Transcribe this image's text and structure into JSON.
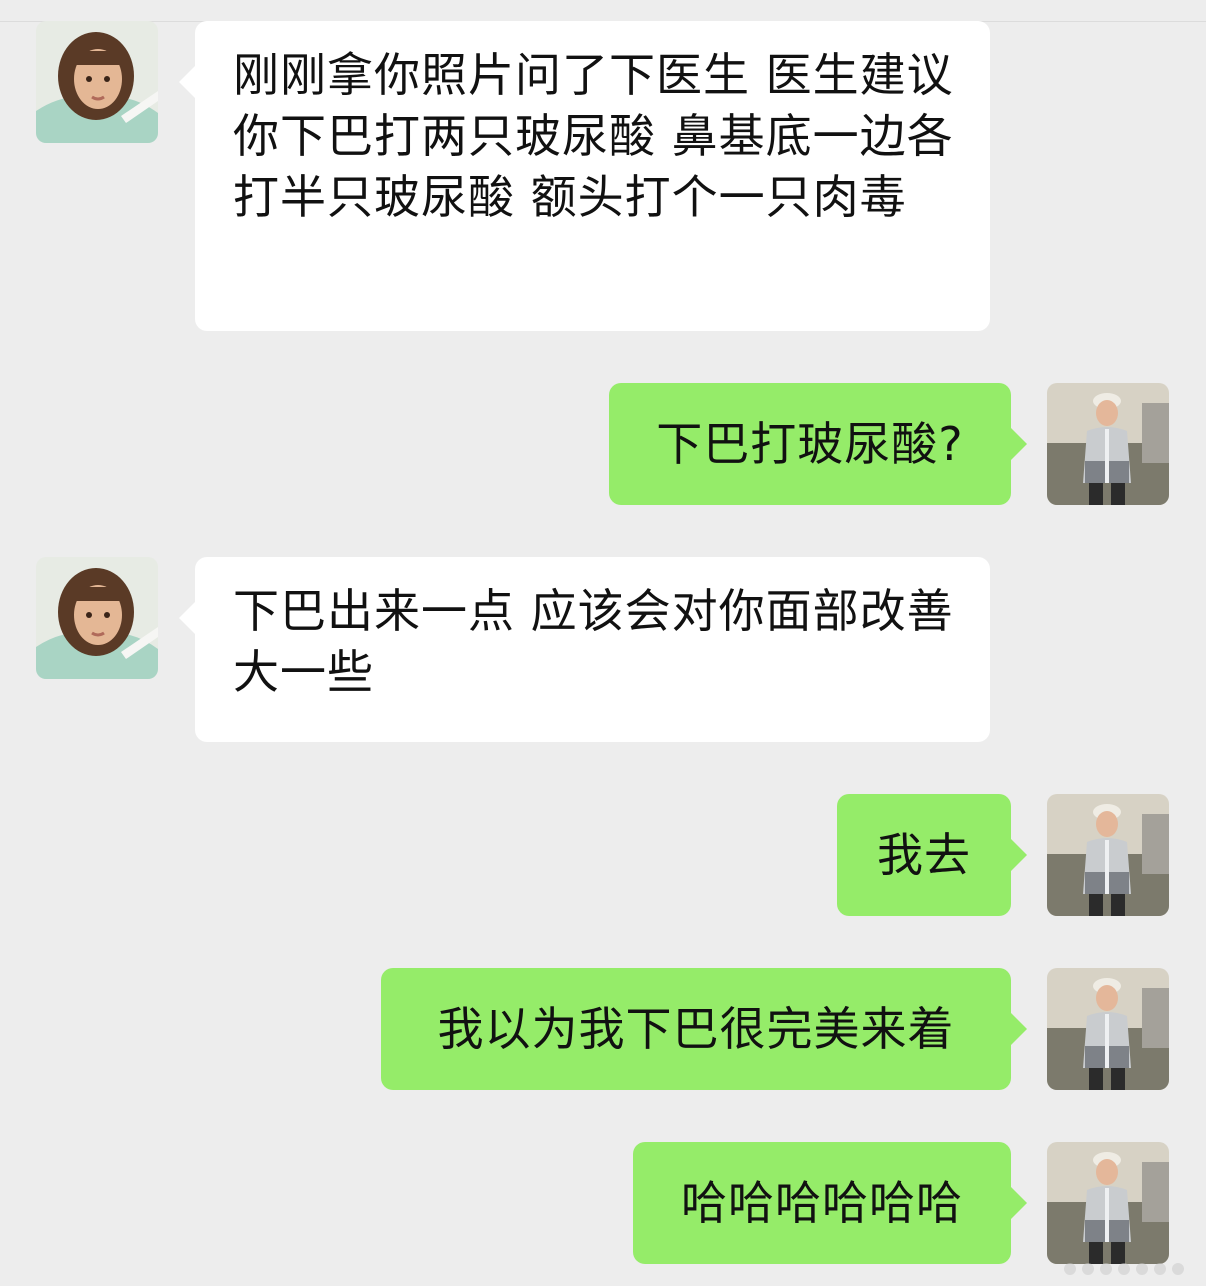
{
  "messages": [
    {
      "side": "left",
      "text": "刚刚拿你照片问了下医生 医生建议你下巴打两只玻尿酸 鼻基底一边各打半只玻尿酸 额头打个一只肉毒"
    },
    {
      "side": "right",
      "text": "下巴打玻尿酸?"
    },
    {
      "side": "left",
      "text": "下巴出来一点 应该会对你面部改善大一些"
    },
    {
      "side": "right",
      "text": "我去"
    },
    {
      "side": "right",
      "text": "我以为我下巴很完美来着"
    },
    {
      "side": "right",
      "text": "哈哈哈哈哈哈"
    }
  ],
  "colors": {
    "background": "#ededed",
    "incoming_bubble": "#ffffff",
    "outgoing_bubble": "#95ec69"
  }
}
